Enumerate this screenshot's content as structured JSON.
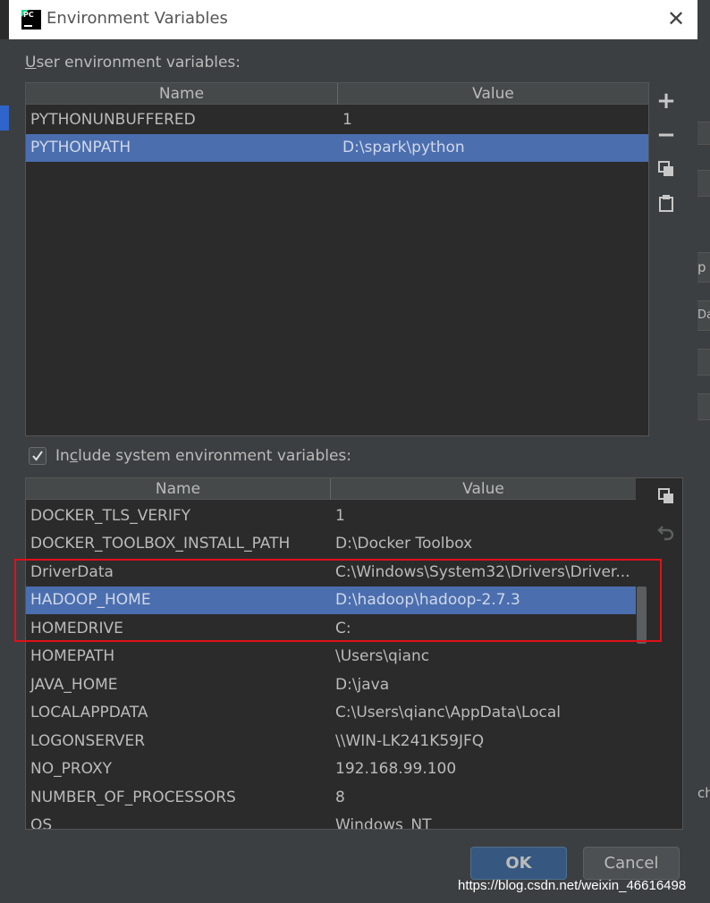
{
  "window": {
    "title": "Environment Variables"
  },
  "user_section": {
    "label_prefix": "U",
    "label_rest": "ser environment variables:",
    "columns": [
      "Name",
      "Value"
    ],
    "rows": [
      {
        "name": "PYTHONUNBUFFERED",
        "value": "1"
      },
      {
        "name": "PYTHONPATH",
        "value": "D:\\spark\\python"
      }
    ],
    "selected_index": 1
  },
  "system_section": {
    "checked": true,
    "label_pre": "In",
    "label_u": "c",
    "label_rest": "lude system environment variables:",
    "columns": [
      "Name",
      "Value"
    ],
    "rows": [
      {
        "name": "DOCKER_TLS_VERIFY",
        "value": "1"
      },
      {
        "name": "DOCKER_TOOLBOX_INSTALL_PATH",
        "value": "D:\\Docker Toolbox"
      },
      {
        "name": "DriverData",
        "value": "C:\\Windows\\System32\\Drivers\\Driver..."
      },
      {
        "name": "HADOOP_HOME",
        "value": "D:\\hadoop\\hadoop-2.7.3"
      },
      {
        "name": "HOMEDRIVE",
        "value": "C:"
      },
      {
        "name": "HOMEPATH",
        "value": "\\Users\\qianc"
      },
      {
        "name": "JAVA_HOME",
        "value": "D:\\java"
      },
      {
        "name": "LOCALAPPDATA",
        "value": "C:\\Users\\qianc\\AppData\\Local"
      },
      {
        "name": "LOGONSERVER",
        "value": "\\\\WIN-LK241K59JFQ"
      },
      {
        "name": "NO_PROXY",
        "value": "192.168.99.100"
      },
      {
        "name": "NUMBER_OF_PROCESSORS",
        "value": "8"
      },
      {
        "name": "OS",
        "value": "Windows_NT"
      }
    ],
    "selected_index": 3
  },
  "user_tools": [
    "add-icon",
    "remove-icon",
    "copy-icon",
    "paste-icon"
  ],
  "system_tools": [
    "copy-icon",
    "undo-icon"
  ],
  "buttons": {
    "ok": "OK",
    "cancel": "Cancel"
  },
  "watermark": "https://blog.csdn.net/weixin_46616498",
  "background_fragments": [
    "p",
    "Da",
    "ch"
  ],
  "colors": {
    "selection": "#4b6eaf",
    "highlight_box": "#e0101a",
    "ok_button": "#365880"
  }
}
